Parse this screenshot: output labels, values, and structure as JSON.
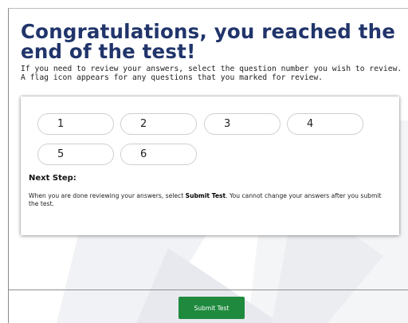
{
  "title": "Congratulations, you reached the end of the test!",
  "instructions": "If you need to review your answers, select the question number you wish to review. A flag icon appears for any questions that you marked for review.",
  "questions": [
    "1",
    "2",
    "3",
    "4",
    "5",
    "6"
  ],
  "next_step": {
    "heading": "Next Step:",
    "body_pre": "When you are done reviewing your answers, select ",
    "body_bold": "Submit Test",
    "body_post": ". You cannot change your answers after you submit the test."
  },
  "submit_label": "Submit Test",
  "colors": {
    "title": "#21356b",
    "submit": "#1f8a3e"
  }
}
